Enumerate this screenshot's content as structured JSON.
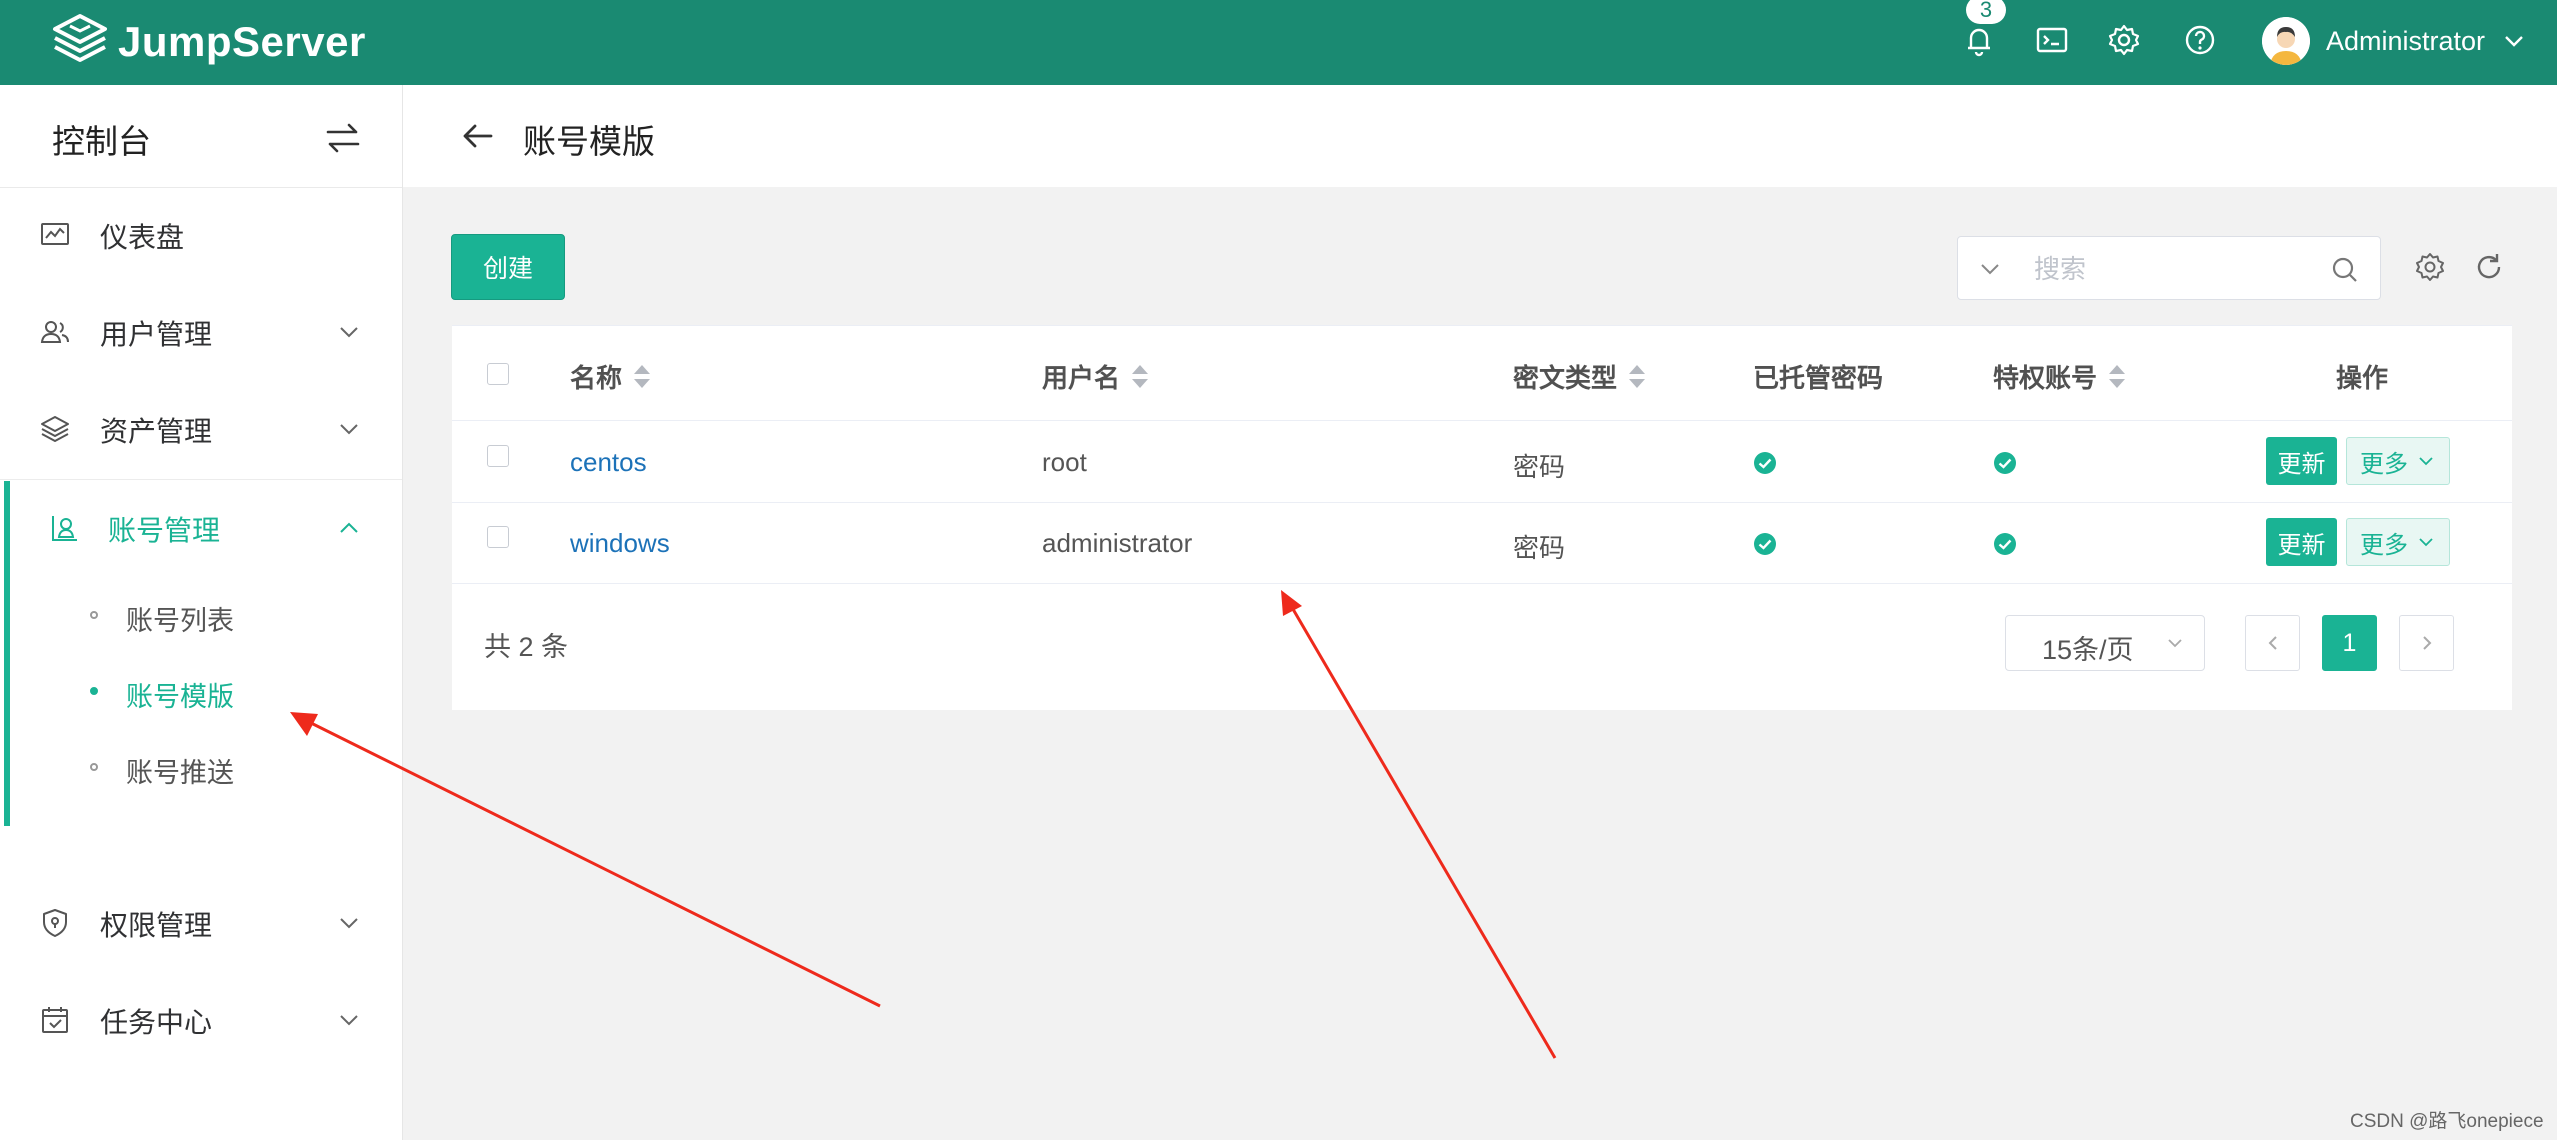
{
  "app": {
    "brand": "JumpServer",
    "notification_count": "3",
    "user_name": "Administrator"
  },
  "colors": {
    "header_bg": "#1a8a72",
    "accent": "#1ab394",
    "link": "#1c72b8",
    "annotation_arrow": "#ee2a1c"
  },
  "sidebar": {
    "title": "控制台",
    "menu": {
      "dashboard": "仪表盘",
      "users": "用户管理",
      "assets": "资产管理",
      "accounts": "账号管理",
      "perms": "权限管理",
      "tasks": "任务中心"
    },
    "accounts_sub": {
      "list": "账号列表",
      "templates": "账号模版",
      "push": "账号推送"
    }
  },
  "page": {
    "title": "账号模版"
  },
  "toolbar": {
    "create_label": "创建",
    "search_placeholder": "搜索"
  },
  "table": {
    "columns": {
      "name": "名称",
      "username": "用户名",
      "secret_type": "密文类型",
      "managed_password": "已托管密码",
      "privileged": "特权账号",
      "actions": "操作"
    },
    "rows": [
      {
        "name": "centos",
        "username": "root",
        "secret_type": "密码",
        "managed_password": true,
        "privileged": true,
        "update": "更新",
        "more": "更多"
      },
      {
        "name": "windows",
        "username": "administrator",
        "secret_type": "密码",
        "managed_password": true,
        "privileged": true,
        "update": "更新",
        "more": "更多"
      }
    ]
  },
  "pagination": {
    "total_text": "共 2 条",
    "page_size": "15条/页",
    "current_page": "1"
  },
  "watermark": "CSDN @路飞onepiece"
}
